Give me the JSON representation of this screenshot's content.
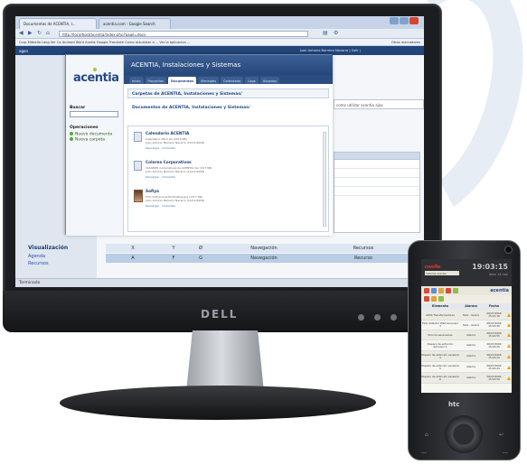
{
  "browser": {
    "tabs": [
      "Documentos de ACENTIA, I...",
      "acentia.com - Google Search"
    ],
    "url": "http://localhost/acentia/index.php?page=docs",
    "bookmarks": "Corp  Mibrella  Lang  Ver  Ca  Android  Word  Auntie  Google Translate  Como actualizar a ...  Ver la aplicacion ...",
    "other_bookmarks": "Otros marcadores",
    "app_header_left": "agon",
    "app_header_right": "Juan Antonio Barreiro Navarro | Salir |"
  },
  "background_page": {
    "side_text": "como utilizar acentia ajax",
    "visualizacion_title": "Visualización",
    "links": [
      "Agenda",
      "Recursos"
    ],
    "table_header": [
      "X",
      "Y",
      "Ø",
      "Navegación",
      "Recursos"
    ],
    "table_row": [
      "A",
      "F",
      "G",
      "Navegación",
      "Recurso"
    ],
    "status": "Terminado"
  },
  "popup": {
    "logo": "acentia",
    "title": "ACENTIA, Instalaciones y Sistemas",
    "tabs": [
      "Inicio",
      "Proyectos",
      "Documentos",
      "Mensajes",
      "Calendario",
      "Logs",
      "Usuarios"
    ],
    "active_tab": "Documentos",
    "search_label": "Buscar",
    "operations_label": "Operaciones",
    "operations": [
      "Nuevo documento",
      "Nueva carpeta"
    ],
    "path_folders": "Carpetas de ACENTIA, Instalaciones y Sistemas/",
    "path_documents": "Documentos de ACENTIA, Instalaciones y Sistemas/",
    "documents": [
      {
        "title": "Calendario ACENTIA",
        "lines": [
          "Calendario 2010.xls (2019 KB)",
          "Juan Antonio Barreiro Navarro (14/11/2009)"
        ],
        "actions": "Descargar · Comentar"
      },
      {
        "title": "Colores Corporativos",
        "lines": [
          "COLORES Corporativos de ACENTIA.doc (617 KB)",
          "Juan Antonio Barreiro Navarro (14/11/2009)"
        ],
        "actions": "Descargar · Comentar"
      },
      {
        "title": "Sofiya",
        "lines": [
          "Foto Sofiya-Acentia-Pinellas.jpg (1717 KB)",
          "Juan Antonio Barreiro Navarro (14/11/2009)"
        ],
        "actions": "Descargar · Comentar"
      }
    ]
  },
  "monitor": {
    "brand": "DELL"
  },
  "phone": {
    "logo": "conflo",
    "bar_text": "Sistema Acentia",
    "time": "19:03:15",
    "date": "dom 14 nov",
    "brand": "acentia",
    "htc": "htc",
    "headers": [
      "Elemento",
      "Alarma",
      "Fecha"
    ],
    "rows": [
      [
        "UPSS Transformadores",
        "Fallo - Avería",
        "06/07/2009 15:21:18"
      ],
      [
        "Fallo detector WSD ascensor 3",
        "Fallo - Avería",
        "06/07/2009 15:24:28"
      ],
      [
        "Paro de ascensores",
        "Alarma",
        "06/07/2009 15:24:55"
      ],
      [
        "Disparo de extinción ascensor 1",
        "Alarma",
        "06/07/2009 15:24:25"
      ],
      [
        "Disparo de extinción escalera 4",
        "Alarma",
        "06/07/2009 15:24:24"
      ],
      [
        "Disparo de extinción escalera 5",
        "Alarma",
        "06/07/2009 15:24:24"
      ],
      [
        "Disparo de extinción escalera 6",
        "Alarma",
        "06/07/2009 15:23:59"
      ]
    ]
  },
  "colors": {
    "brand_blue": "#244a86",
    "warning": "#e9a100",
    "header_red": "#e53a2b"
  }
}
